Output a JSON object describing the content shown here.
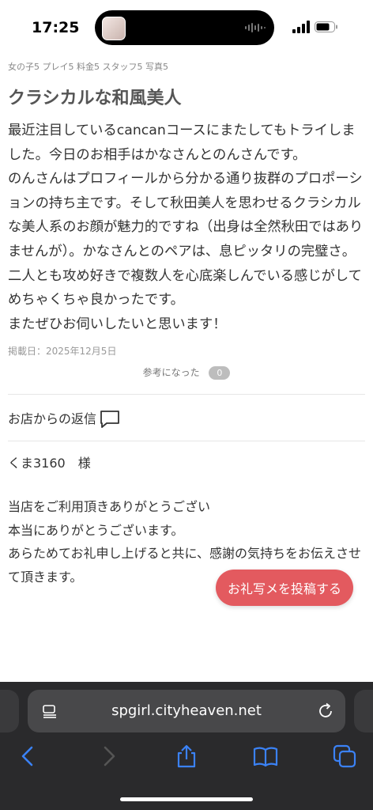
{
  "status_bar": {
    "time": "17:25"
  },
  "article": {
    "tags": "女の子5 プレイ5 料金5 スタッフ5 写真5",
    "title": "クラシカルな和風美人",
    "paragraphs": [
      "最近注目しているcancanコースにまたしてもトライしました。今日のお相手はかなさんとのんさんです。",
      "のんさんはプロフィールから分かる通り抜群のプロポーションの持ち主です。そして秋田美人を思わせるクラシカルな美人系のお顔が魅力的ですね（出身は全然秋田ではありませんが）。かなさんとのペアは、息ピッタリの完璧さ。二人とも攻め好きで複数人を心底楽しんでいる感じがしてめちゃくちゃ良かったです。",
      "またぜひお伺いしたいと思います！"
    ],
    "posted_date": "掲載日：2025年12月5日",
    "helpful_label": "参考になった",
    "helpful_count": "0"
  },
  "reply": {
    "section_label": "お店からの返信",
    "recipient": "くま3160　様",
    "lines": [
      "当店をご利用頂きありがとうござい",
      "本当にありがとうございます。",
      "あらためてお礼申し上げると共に、感謝の気持ちをお伝えさせて頂きます。"
    ]
  },
  "floating_button": {
    "label": "お礼写メを投稿する",
    "color": "#e35a5f"
  },
  "browser": {
    "url": "spgirl.cityheaven.net",
    "toolbar_icons": [
      "back-icon",
      "forward-icon",
      "share-icon",
      "bookmarks-icon",
      "tabs-icon"
    ],
    "accent": "#3b82f6"
  }
}
